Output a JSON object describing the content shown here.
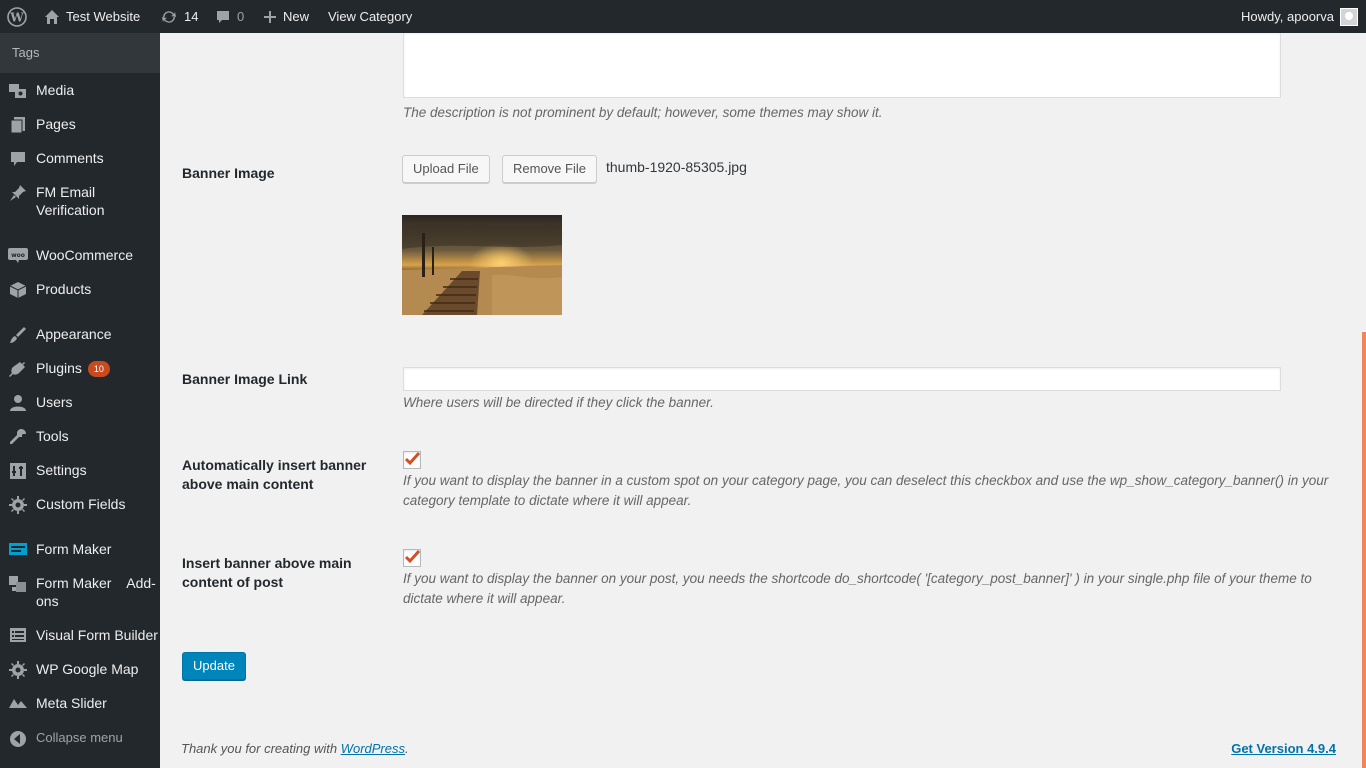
{
  "adminbar": {
    "site_name": "Test Website",
    "updates_count": "14",
    "comments_count": "0",
    "new_label": "New",
    "view_label": "View Category",
    "howdy": "Howdy, apoorva"
  },
  "sidebar": {
    "submenu_item": "Tags",
    "items": [
      {
        "label": "Media",
        "icon": "media-icon"
      },
      {
        "label": "Pages",
        "icon": "pages-icon"
      },
      {
        "label": "Comments",
        "icon": "comments-icon"
      },
      {
        "label": "FM Email Verification",
        "icon": "pin-icon"
      },
      {
        "label": "WooCommerce",
        "icon": "woocommerce-icon"
      },
      {
        "label": "Products",
        "icon": "products-icon"
      },
      {
        "label": "Appearance",
        "icon": "appearance-icon"
      },
      {
        "label": "Plugins",
        "icon": "plugins-icon",
        "badge": "10"
      },
      {
        "label": "Users",
        "icon": "users-icon"
      },
      {
        "label": "Tools",
        "icon": "tools-icon"
      },
      {
        "label": "Settings",
        "icon": "settings-icon"
      },
      {
        "label": "Custom Fields",
        "icon": "custom-fields-icon"
      },
      {
        "label": "Form Maker",
        "icon": "form-maker-icon"
      },
      {
        "label": "Form Maker    Add-ons",
        "icon": "form-maker-addons-icon"
      },
      {
        "label": "Visual Form Builder",
        "icon": "visual-form-builder-icon"
      },
      {
        "label": "WP Google Map",
        "icon": "gear-icon"
      },
      {
        "label": "Meta Slider",
        "icon": "meta-slider-icon"
      }
    ],
    "collapse_label": "Collapse menu"
  },
  "form": {
    "description_help": "The description is not prominent by default; however, some themes may show it.",
    "banner_image_label": "Banner Image",
    "upload_button": "Upload File",
    "remove_button": "Remove File",
    "filename": "thumb-1920-85305.jpg",
    "banner_link_label": "Banner Image Link",
    "banner_link_value": "",
    "banner_link_help": "Where users will be directed if they click the banner.",
    "auto_insert_label": "Automatically insert banner above main content",
    "auto_insert_checked": true,
    "auto_insert_help": "If you want to display the banner in a custom spot on your category page, you can deselect this checkbox and use the wp_show_category_banner() in your category template to dictate where it will appear.",
    "post_insert_label": "Insert banner above main content of post",
    "post_insert_checked": true,
    "post_insert_help": "If you want to display the banner on your post, you needs the shortcode do_shortcode( '[category_post_banner]' ) in your single.php file of your theme to dictate where it will appear.",
    "update_button": "Update"
  },
  "footer": {
    "thanks_prefix": "Thank you for creating with ",
    "thanks_link": "WordPress",
    "thanks_suffix": ".",
    "version": "Get Version 4.9.4"
  },
  "colors": {
    "accent": "#0085ba",
    "checkbox": "#d54e21",
    "adminbar": "#23282d"
  }
}
